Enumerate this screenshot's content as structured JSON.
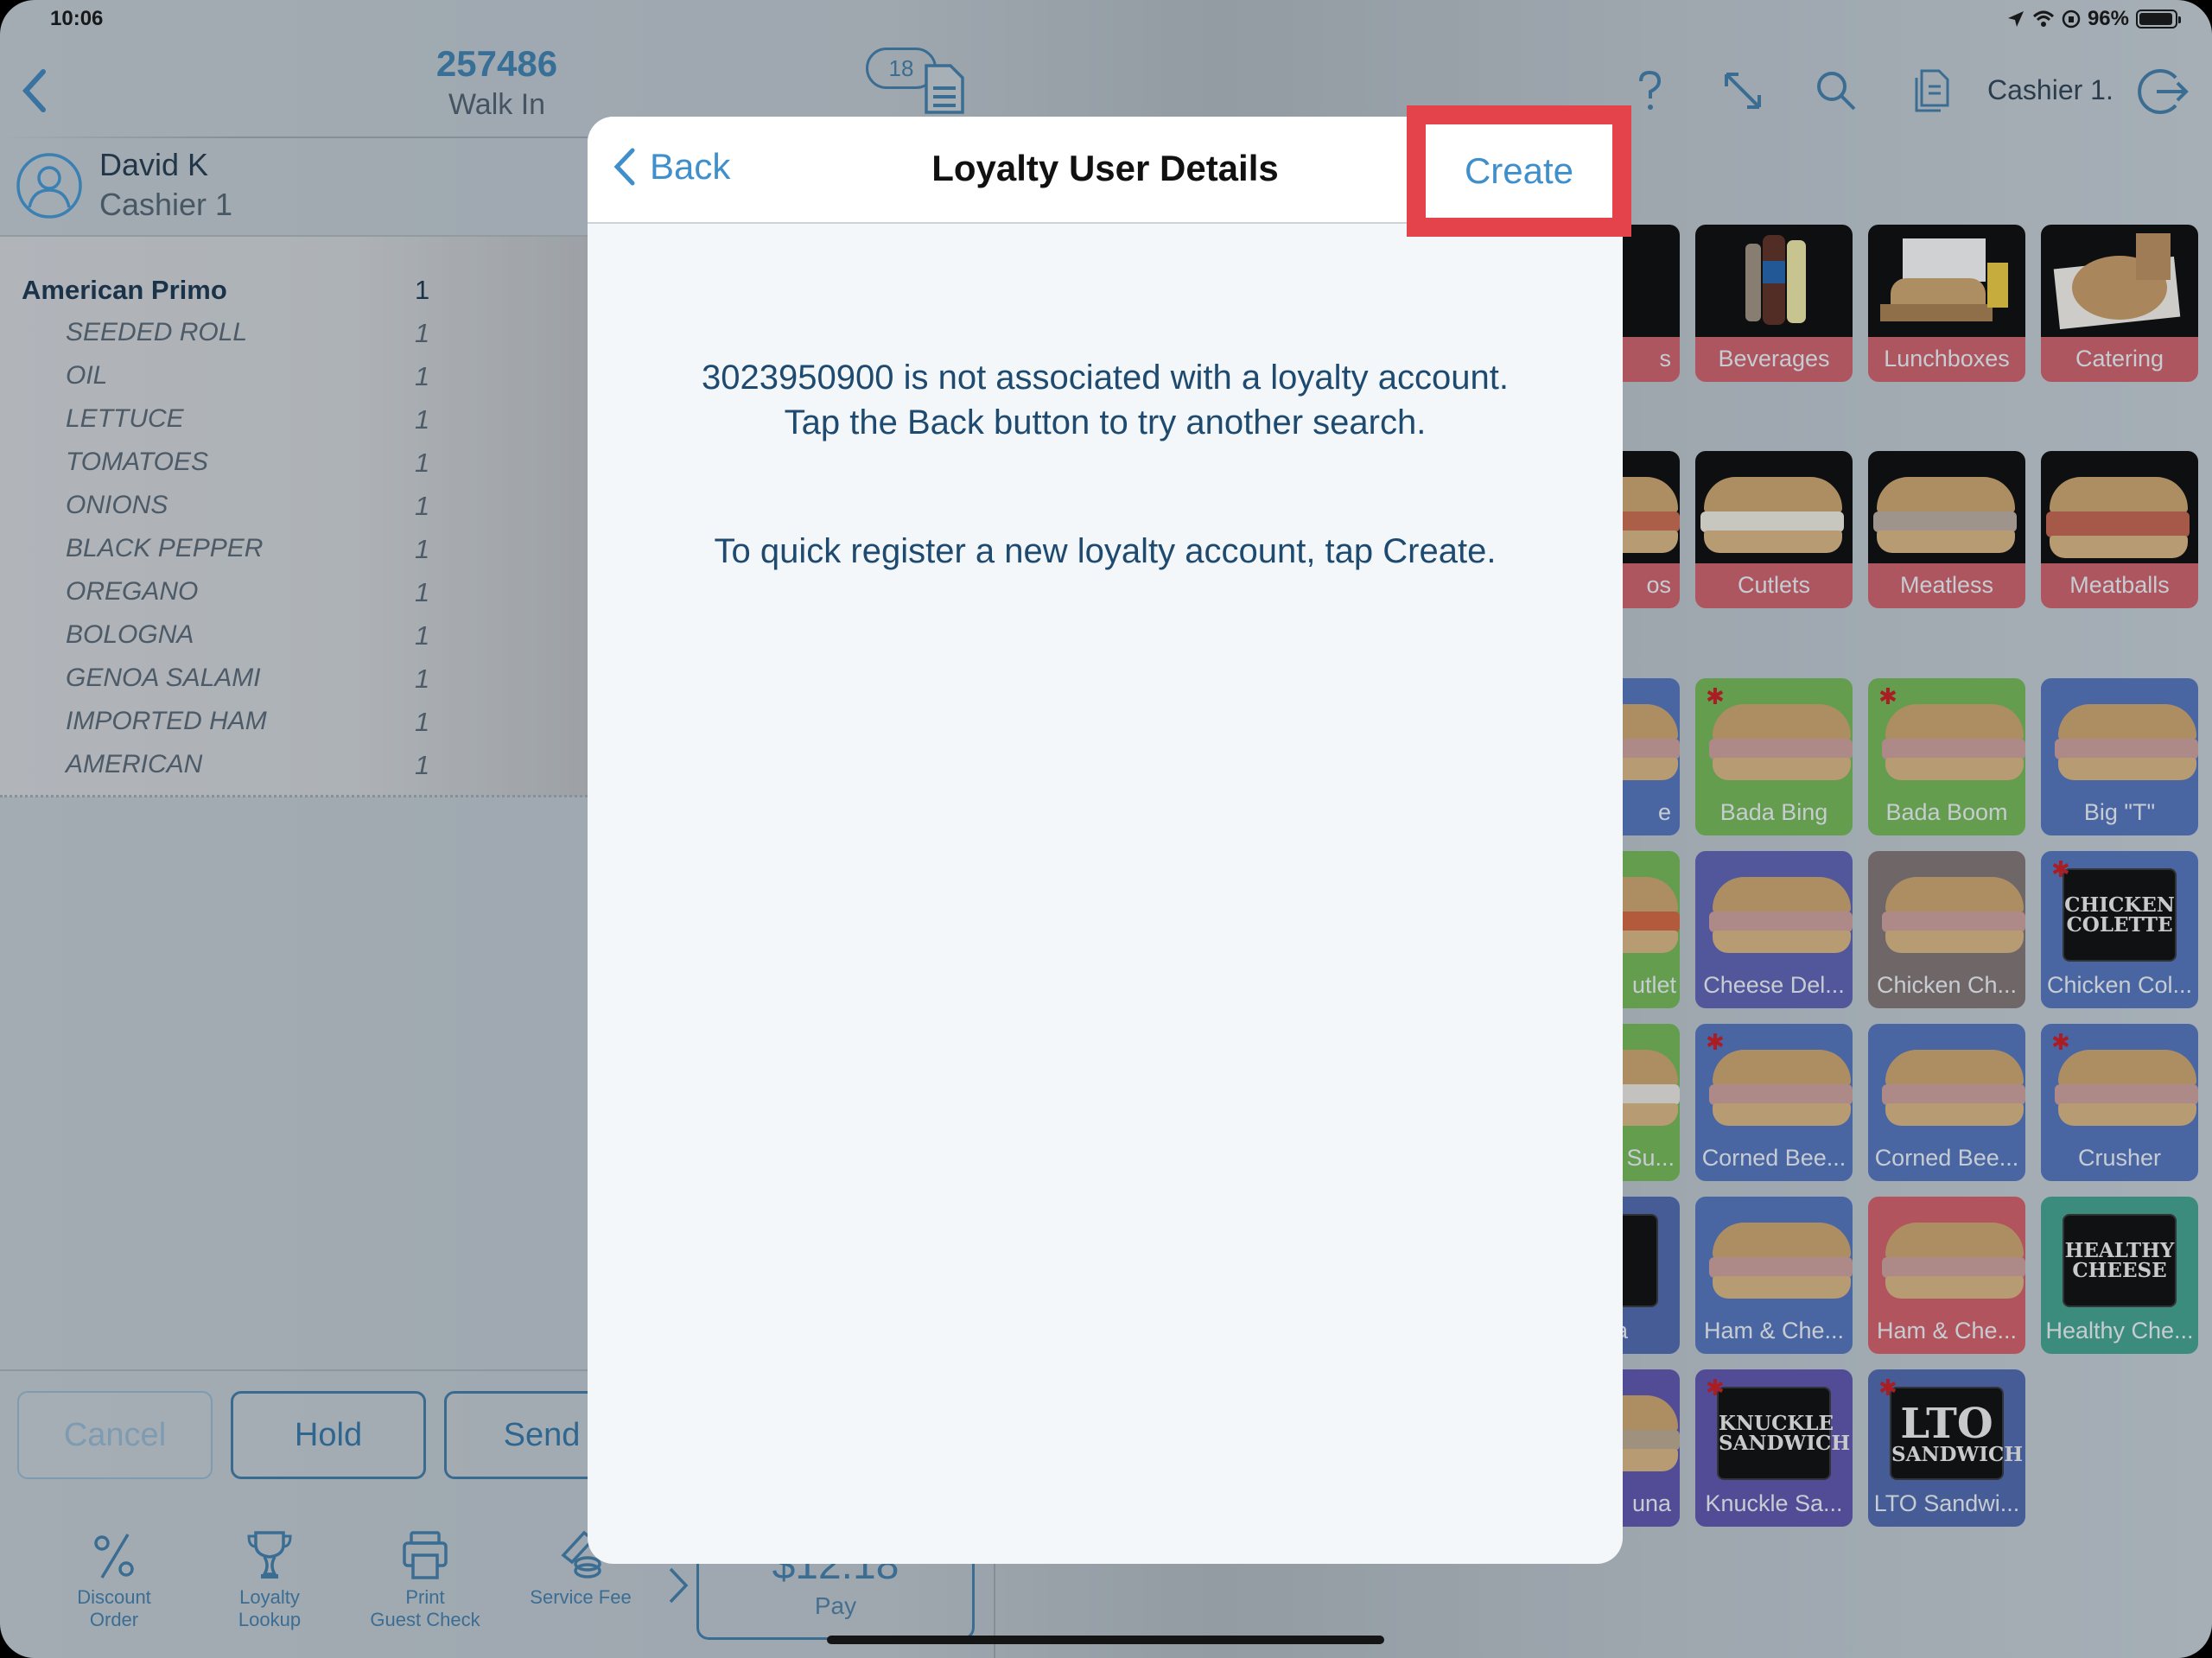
{
  "status_bar": {
    "time": "10:06",
    "battery_text": "96%",
    "battery_level": 0.96,
    "icons": [
      "location-arrow-icon",
      "wifi-icon",
      "orientation-lock-icon",
      "battery-icon"
    ]
  },
  "header": {
    "back_icon": "chevron-left-icon",
    "order_number": "257486",
    "order_type": "Walk In",
    "ticket_badge": "18",
    "icons": [
      "help-icon",
      "resize-icon",
      "search-icon",
      "document-icon",
      "logout-icon"
    ],
    "cashier": "Cashier 1."
  },
  "customer": {
    "name": "David K",
    "role": "Cashier 1"
  },
  "order": {
    "item": {
      "name": "American Primo",
      "qty": "1"
    },
    "modifiers": [
      {
        "name": "SEEDED ROLL",
        "qty": "1"
      },
      {
        "name": "OIL",
        "qty": "1"
      },
      {
        "name": "LETTUCE",
        "qty": "1"
      },
      {
        "name": "TOMATOES",
        "qty": "1"
      },
      {
        "name": "ONIONS",
        "qty": "1"
      },
      {
        "name": "BLACK PEPPER",
        "qty": "1"
      },
      {
        "name": "OREGANO",
        "qty": "1"
      },
      {
        "name": "BOLOGNA",
        "qty": "1"
      },
      {
        "name": "GENOA SALAMI",
        "qty": "1"
      },
      {
        "name": "IMPORTED HAM",
        "qty": "1"
      },
      {
        "name": "AMERICAN",
        "qty": "1"
      }
    ]
  },
  "actions": {
    "cancel": "Cancel",
    "hold": "Hold",
    "send": "Send"
  },
  "toolbar": [
    {
      "label_1": "Discount",
      "label_2": "Order",
      "icon": "percent-icon"
    },
    {
      "label_1": "Loyalty",
      "label_2": "Lookup",
      "icon": "trophy-icon"
    },
    {
      "label_1": "Print",
      "label_2": "Guest Check",
      "icon": "printer-icon"
    },
    {
      "label_1": "",
      "label_2": "Service Fee",
      "icon": "coins-icon"
    }
  ],
  "pay": {
    "amount": "$12.18",
    "label": "Pay"
  },
  "categories": [
    {
      "label": "Beverages"
    },
    {
      "label": "Lunchboxes"
    },
    {
      "label": "Catering"
    },
    {
      "label": "Cutlets"
    },
    {
      "label": "Meatless"
    },
    {
      "label": "Meatballs"
    }
  ],
  "partial_labels": [
    "s",
    "os",
    "e",
    "utlet",
    "Su...",
    "a",
    "una"
  ],
  "products": [
    {
      "label": "Bada Bing",
      "color": "#6eb24f",
      "starred": true
    },
    {
      "label": "Bada Boom",
      "color": "#6eb24f",
      "starred": true
    },
    {
      "label": "Big \"T\"",
      "color": "#4f6fb8",
      "starred": false
    },
    {
      "label": "Cheese Del...",
      "color": "#5a5cae",
      "starred": false
    },
    {
      "label": "Chicken Ch...",
      "color": "#7d706e",
      "starred": false
    },
    {
      "label": "Chicken Col...",
      "color": "#4f6fb8",
      "starred": true,
      "logo": [
        "CHICKEN",
        "COLETTE"
      ]
    },
    {
      "label": "Corned Bee...",
      "color": "#4f6fb8",
      "starred": true
    },
    {
      "label": "Corned Bee...",
      "color": "#4f6fb8",
      "starred": false
    },
    {
      "label": "Crusher",
      "color": "#4f6fb8",
      "starred": true
    },
    {
      "label": "Ham & Che...",
      "color": "#4f6fb8",
      "starred": false
    },
    {
      "label": "Ham & Che...",
      "color": "#cf5a62",
      "starred": false
    },
    {
      "label": "Healthy Che...",
      "color": "#3e9e88",
      "starred": false,
      "logo": [
        "HEALTHY",
        "CHEESE"
      ]
    },
    {
      "label": "Knuckle Sa...",
      "color": "#5a4fa8",
      "starred": true,
      "logo": [
        "KNUCKLE",
        "SANDWICH"
      ]
    },
    {
      "label": "LTO Sandwi...",
      "color": "#4a63a8",
      "starred": true,
      "logo": [
        "LTO",
        "SANDWICH"
      ]
    }
  ],
  "modal": {
    "back_label": "Back",
    "title": "Loyalty User Details",
    "create_label": "Create",
    "message_line_1": "3023950900 is not associated with a loyalty account.",
    "message_line_2": "Tap the Back button to try another search.",
    "message_line_3": "To quick register a new loyalty account, tap Create."
  },
  "colors": {
    "accent": "#3e8fcb",
    "highlight": "#e5434b",
    "category_tile": "#c85c66"
  }
}
